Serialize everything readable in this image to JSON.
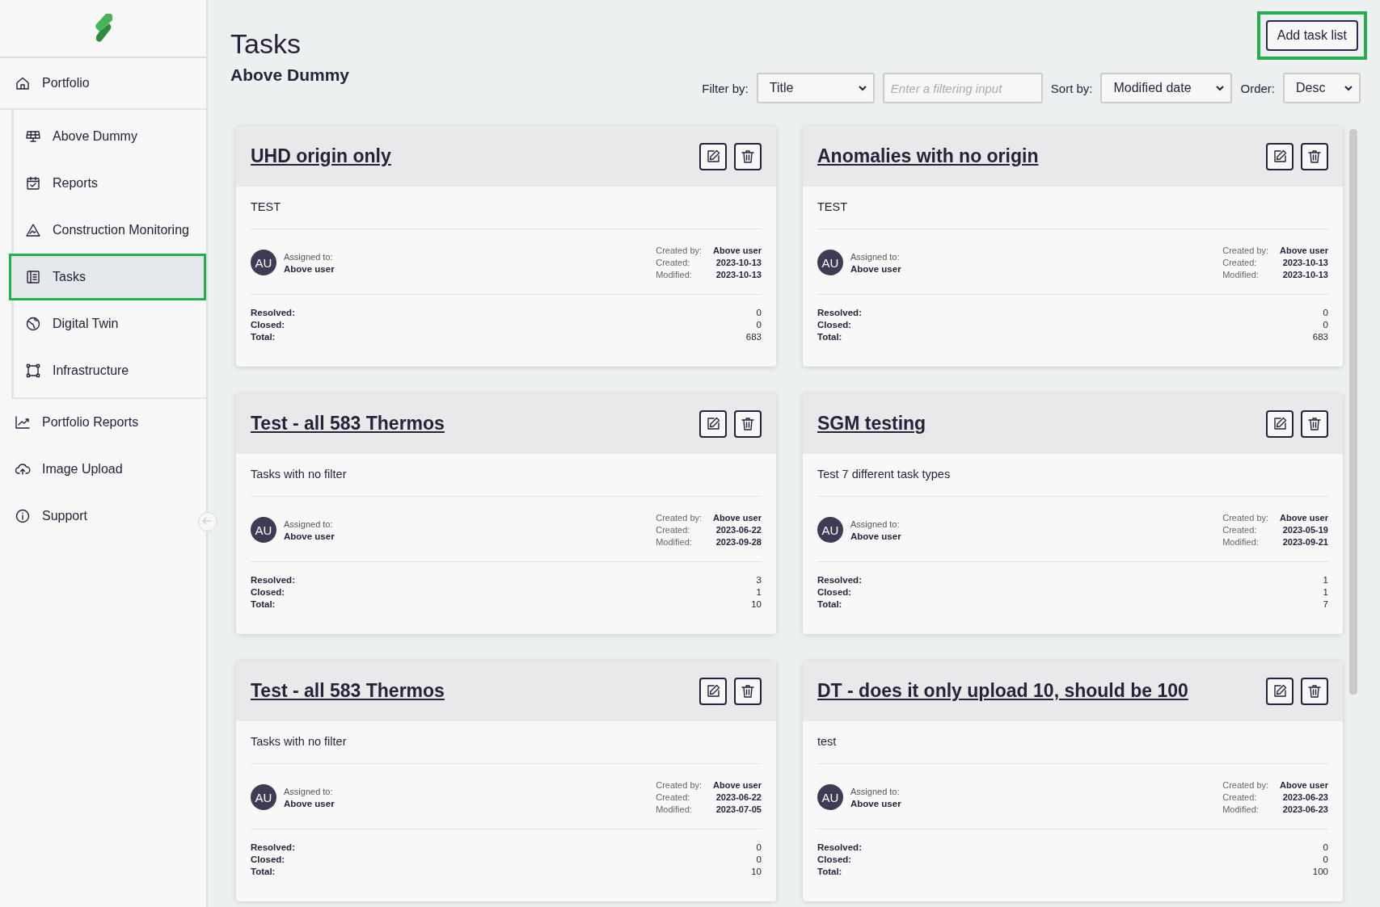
{
  "sidebar": {
    "items": [
      {
        "label": "Portfolio",
        "selected": false,
        "highlighted": false,
        "children": [
          {
            "label": "Above Dummy",
            "selected": false,
            "highlighted": false
          },
          {
            "label": "Reports",
            "selected": false,
            "highlighted": false
          },
          {
            "label": "Construction Monitoring",
            "selected": false,
            "highlighted": false
          },
          {
            "label": "Tasks",
            "selected": true,
            "highlighted": true
          },
          {
            "label": "Digital Twin",
            "selected": false,
            "highlighted": false
          },
          {
            "label": "Infrastructure",
            "selected": false,
            "highlighted": false
          }
        ]
      },
      {
        "label": "Portfolio Reports",
        "selected": false,
        "highlighted": false
      },
      {
        "label": "Image Upload",
        "selected": false,
        "highlighted": false
      },
      {
        "label": "Support",
        "selected": false,
        "highlighted": false
      }
    ]
  },
  "header": {
    "title": "Tasks",
    "subtitle": "Above Dummy",
    "add_button": {
      "label": "Add task list",
      "highlighted": true
    }
  },
  "filters": {
    "filter_label": "Filter by:",
    "filter_value": "Title",
    "filter_placeholder": "Enter a filtering input",
    "sort_label": "Sort by:",
    "sort_value": "Modified date",
    "order_label": "Order:",
    "order_value": "Desc"
  },
  "cards": [
    {
      "title": "UHD origin only",
      "description": "TEST",
      "avatar": "AU",
      "assigned_label": "Assigned to:",
      "assigned": "Above user",
      "meta": [
        [
          "Created by:",
          "Above user"
        ],
        [
          "Created:",
          "2023-10-13"
        ],
        [
          "Modified:",
          "2023-10-13"
        ]
      ],
      "stats": [
        [
          "Resolved:",
          "0"
        ],
        [
          "Closed:",
          "0"
        ],
        [
          "Total:",
          "683"
        ]
      ]
    },
    {
      "title": "Anomalies with no origin",
      "description": "TEST",
      "avatar": "AU",
      "assigned_label": "Assigned to:",
      "assigned": "Above user",
      "meta": [
        [
          "Created by:",
          "Above user"
        ],
        [
          "Created:",
          "2023-10-13"
        ],
        [
          "Modified:",
          "2023-10-13"
        ]
      ],
      "stats": [
        [
          "Resolved:",
          "0"
        ],
        [
          "Closed:",
          "0"
        ],
        [
          "Total:",
          "683"
        ]
      ]
    },
    {
      "title": "Test - all 583 Thermos",
      "description": "Tasks with no filter",
      "avatar": "AU",
      "assigned_label": "Assigned to:",
      "assigned": "Above user",
      "meta": [
        [
          "Created by:",
          "Above user"
        ],
        [
          "Created:",
          "2023-06-22"
        ],
        [
          "Modified:",
          "2023-09-28"
        ]
      ],
      "stats": [
        [
          "Resolved:",
          "3"
        ],
        [
          "Closed:",
          "1"
        ],
        [
          "Total:",
          "10"
        ]
      ]
    },
    {
      "title": "SGM testing",
      "description": "Test 7 different task types",
      "avatar": "AU",
      "assigned_label": "Assigned to:",
      "assigned": "Above user",
      "meta": [
        [
          "Created by:",
          "Above user"
        ],
        [
          "Created:",
          "2023-05-19"
        ],
        [
          "Modified:",
          "2023-09-21"
        ]
      ],
      "stats": [
        [
          "Resolved:",
          "1"
        ],
        [
          "Closed:",
          "1"
        ],
        [
          "Total:",
          "7"
        ]
      ]
    },
    {
      "title": "Test - all 583 Thermos",
      "description": "Tasks with no filter",
      "avatar": "AU",
      "assigned_label": "Assigned to:",
      "assigned": "Above user",
      "meta": [
        [
          "Created by:",
          "Above user"
        ],
        [
          "Created:",
          "2023-06-22"
        ],
        [
          "Modified:",
          "2023-07-05"
        ]
      ],
      "stats": [
        [
          "Resolved:",
          "0"
        ],
        [
          "Closed:",
          "0"
        ],
        [
          "Total:",
          "10"
        ]
      ]
    },
    {
      "title": "DT - does it only upload 10, should be 100",
      "description": "test",
      "avatar": "AU",
      "assigned_label": "Assigned to:",
      "assigned": "Above user",
      "meta": [
        [
          "Created by:",
          "Above user"
        ],
        [
          "Created:",
          "2023-06-23"
        ],
        [
          "Modified:",
          "2023-06-23"
        ]
      ],
      "stats": [
        [
          "Resolved:",
          "0"
        ],
        [
          "Closed:",
          "0"
        ],
        [
          "Total:",
          "100"
        ]
      ]
    }
  ]
}
